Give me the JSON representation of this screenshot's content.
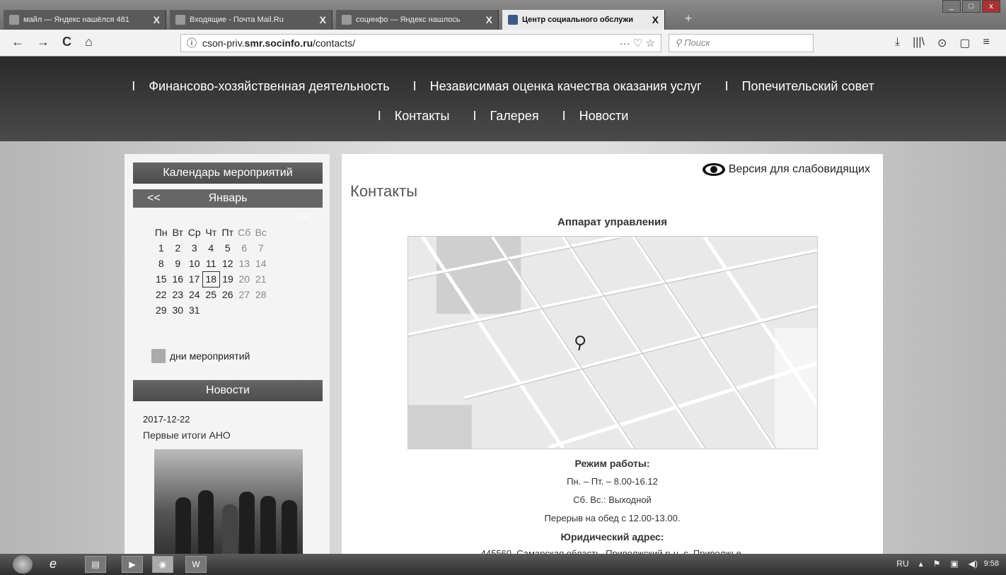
{
  "browser": {
    "tabs": [
      {
        "title": "майл — Яндекс нашёлся 481",
        "active": false
      },
      {
        "title": "Входящие - Почта Mail.Ru",
        "active": false
      },
      {
        "title": "социнфо — Яндекс нашлось",
        "active": false
      },
      {
        "title": "Центр социального обслужи",
        "active": true
      }
    ],
    "tab_close": "X",
    "new_tab": "+",
    "nav": {
      "back": "←",
      "forward": "→",
      "reload": "C",
      "home": "⌂"
    },
    "url_info": "ⓘ",
    "url_prefix": "cson-priv.",
    "url_domain": "smr.socinfo.ru",
    "url_path": "/contacts/",
    "url_actions": "··· ♡ ☆",
    "search_placeholder": "Поиск",
    "right_icons": [
      "⤓",
      "|||\\",
      "⊙",
      "▢",
      "≡"
    ]
  },
  "site": {
    "menu_row1": [
      "Финансово-хозяйственная деятельность",
      "Независимая оценка качества оказания услуг",
      "Попечительский совет"
    ],
    "menu_row2": [
      "Контакты",
      "Галерея",
      "Новости"
    ],
    "separator": "I"
  },
  "sidebar": {
    "calendar_title": "Календарь мероприятий",
    "prev": "<<",
    "next": ">>",
    "month": "Январь",
    "weekdays": [
      "Пн",
      "Вт",
      "Ср",
      "Чт",
      "Пт",
      "Сб",
      "Вс"
    ],
    "weeks": [
      [
        "1",
        "2",
        "3",
        "4",
        "5",
        "6",
        "7"
      ],
      [
        "8",
        "9",
        "10",
        "11",
        "12",
        "13",
        "14"
      ],
      [
        "15",
        "16",
        "17",
        "18",
        "19",
        "20",
        "21"
      ],
      [
        "22",
        "23",
        "24",
        "25",
        "26",
        "27",
        "28"
      ],
      [
        "29",
        "30",
        "31",
        "",
        "",
        "",
        ""
      ]
    ],
    "today": "18",
    "legend": "дни мероприятий",
    "news_title": "Новости",
    "news_date": "2017-12-22",
    "news_headline": "Первые итоги АНО"
  },
  "content": {
    "low_vision": "Версия для слабовидящих",
    "page_title": "Контакты",
    "subtitle": "Аппарат управления",
    "work_hours_title": "Режим работы:",
    "work_hours_line1": "Пн. – Пт. – 8.00-16.12",
    "work_hours_line2": "Сб. Вс.: Выходной",
    "work_hours_line3": "Перерыв на обед с 12.00-13.00.",
    "legal_address_title": "Юридический адрес:",
    "legal_address_partial": "445560, Самарская область, Приволжский р-н, с. Приволжье,"
  },
  "taskbar": {
    "lang": "RU",
    "clock": "9:58"
  },
  "colors": {
    "header_bg": "#333333",
    "sidebar_header": "#555555",
    "content_bg": "#ffffff"
  }
}
